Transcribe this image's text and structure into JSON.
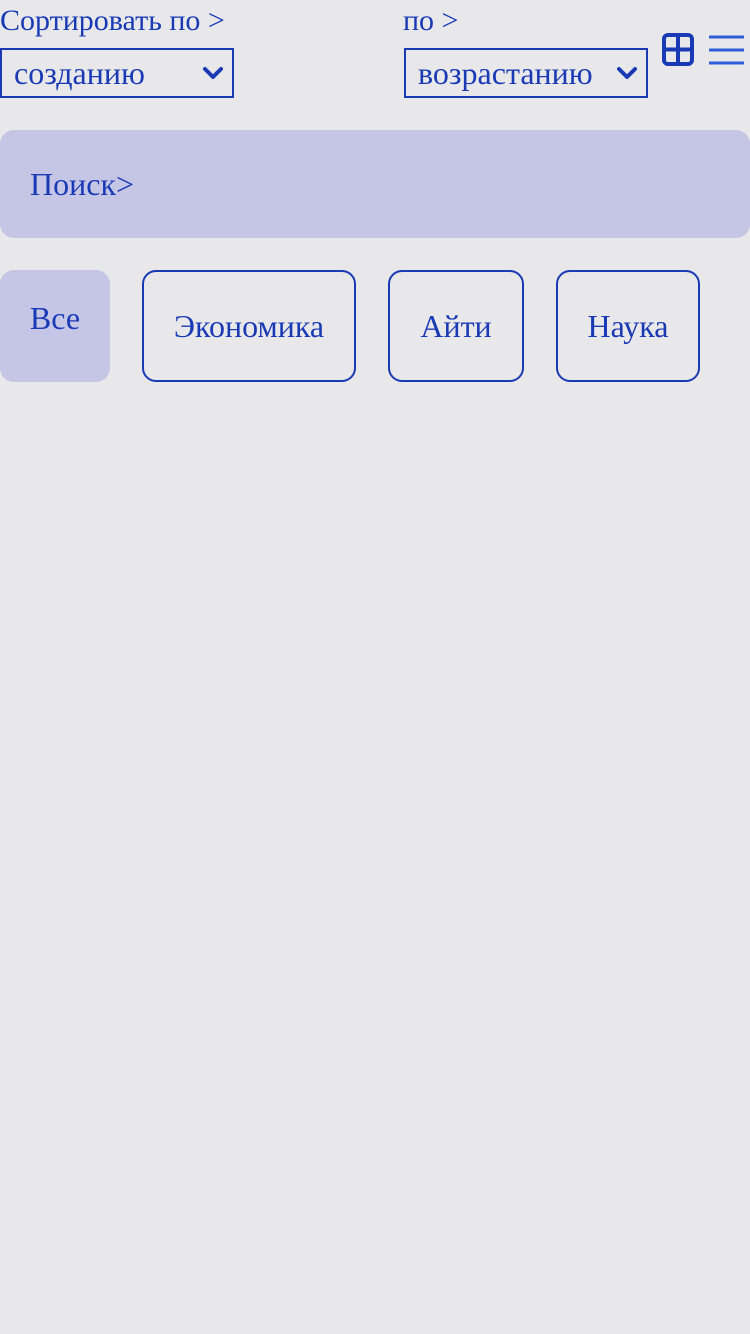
{
  "sort": {
    "label": "Сортировать по >",
    "field_value": "созданию",
    "order_label": "по >",
    "order_value": "возрастанию"
  },
  "view": {
    "grid_icon": "grid-icon",
    "menu_icon": "hamburger-menu-icon"
  },
  "search": {
    "label": "Поиск>"
  },
  "categories": [
    {
      "label": "Все",
      "active": true
    },
    {
      "label": "Экономика",
      "active": false
    },
    {
      "label": "Айти",
      "active": false
    },
    {
      "label": "Наука",
      "active": false
    }
  ],
  "colors": {
    "accent": "#1a3ab5",
    "chip_active_bg": "#c5c5e6",
    "background": "#e8e8ea"
  }
}
